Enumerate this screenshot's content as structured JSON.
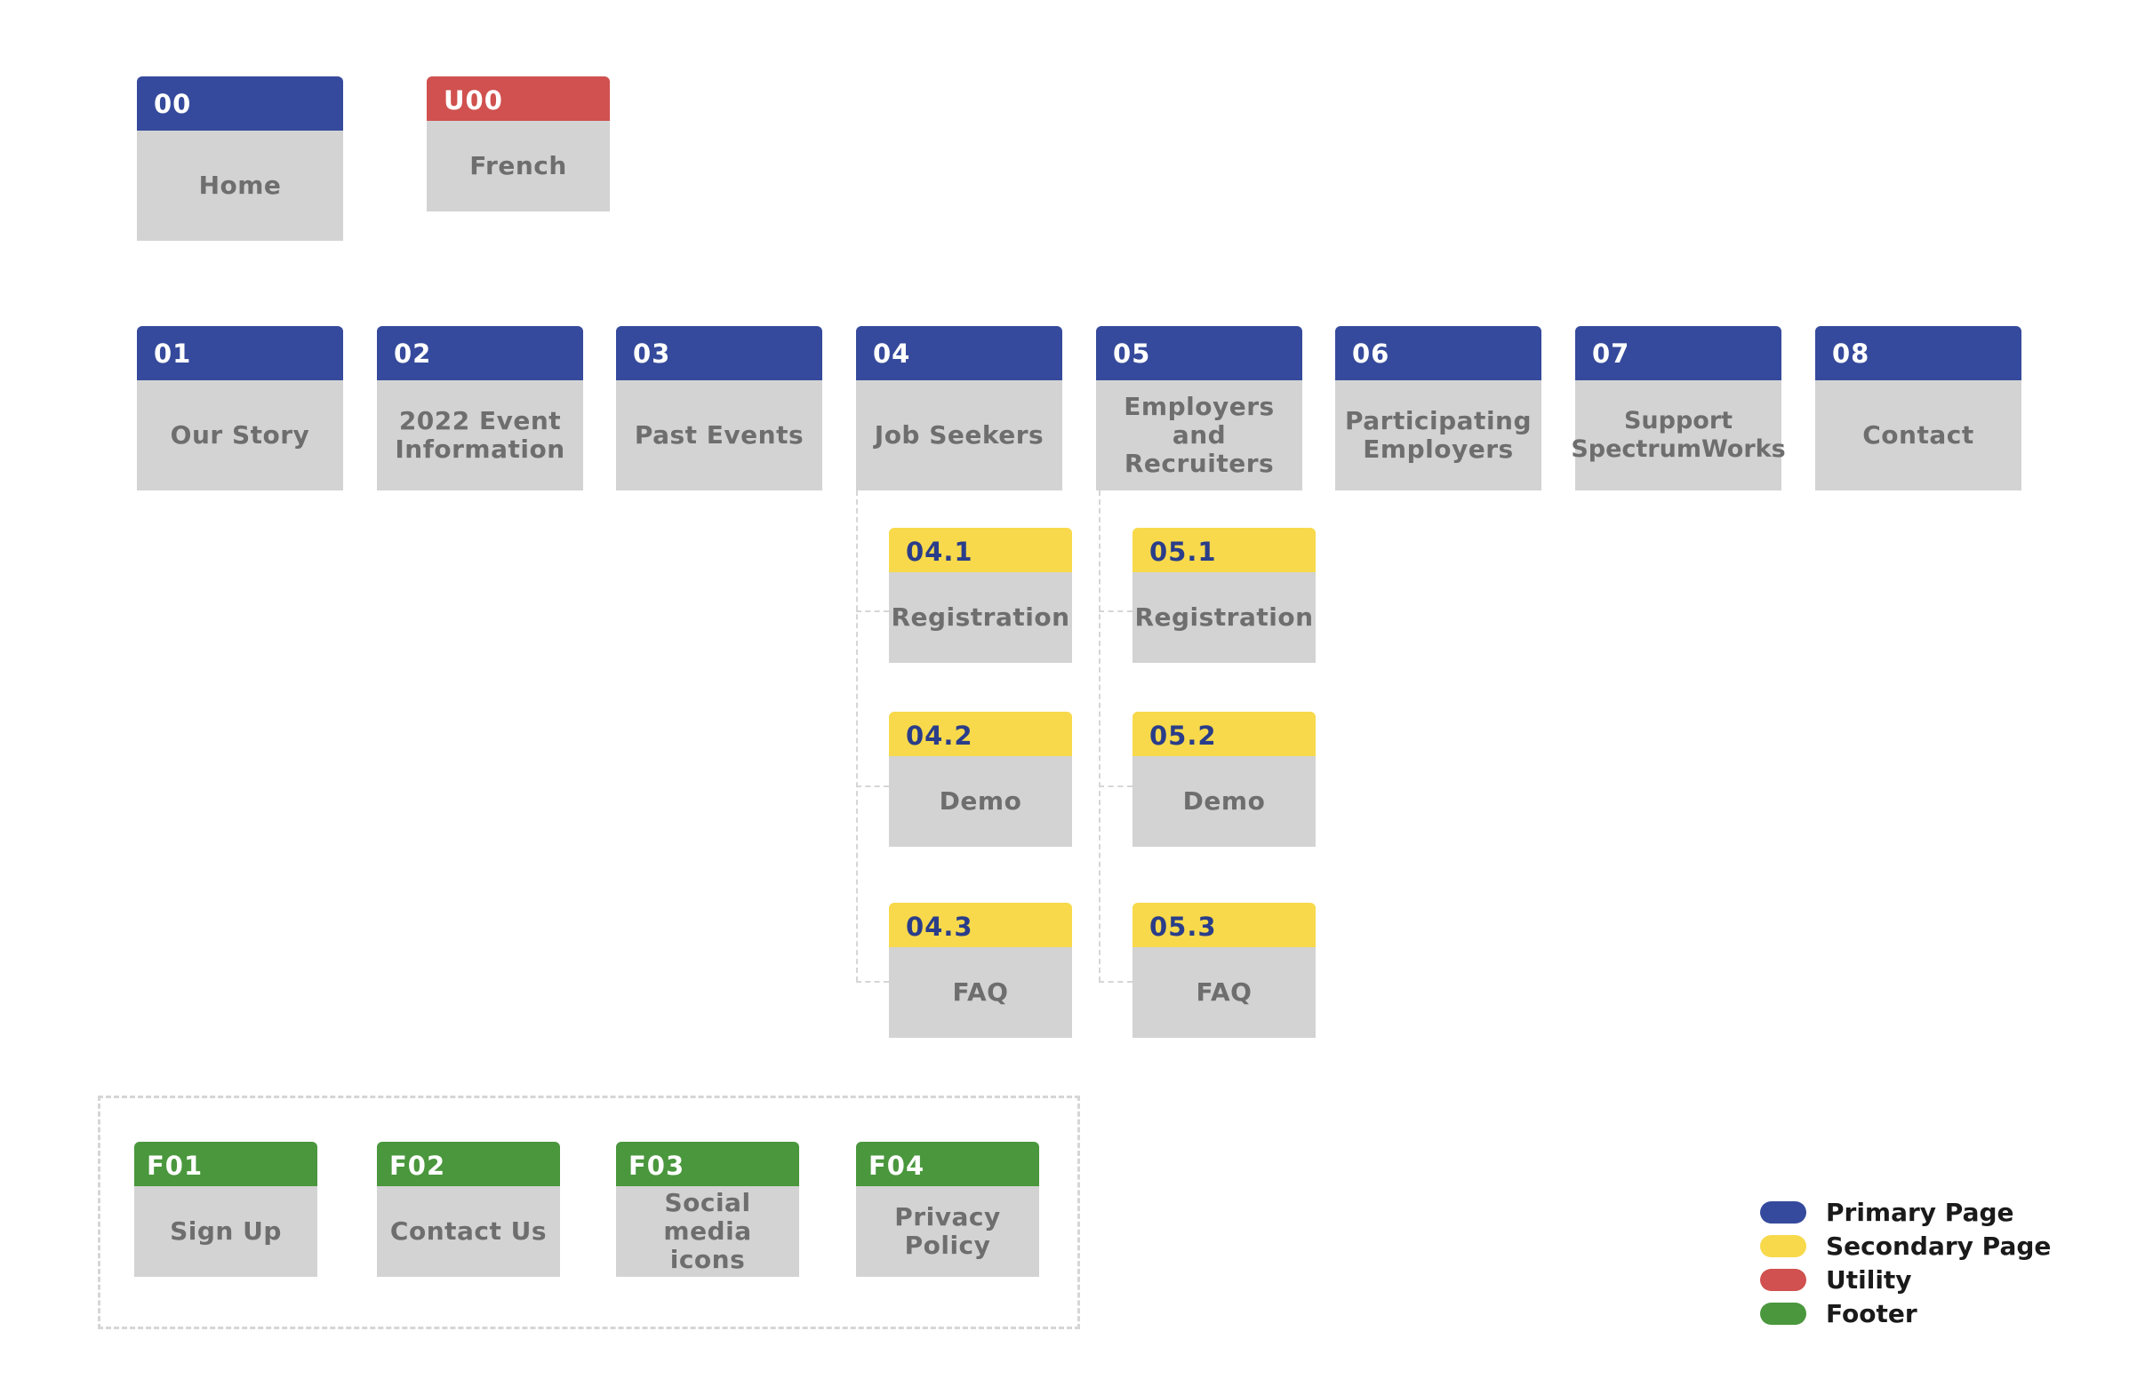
{
  "colors": {
    "primary": "#354a9c",
    "secondary": "#f7d94b",
    "utility": "#d0514f",
    "footer": "#4a973d",
    "card_body": "#d3d3d3"
  },
  "top": {
    "home": {
      "code": "00",
      "label": "Home"
    },
    "french": {
      "code": "U00",
      "label": "French"
    }
  },
  "primary_pages": [
    {
      "code": "01",
      "label": "Our Story"
    },
    {
      "code": "02",
      "label": "2022 Event Information"
    },
    {
      "code": "03",
      "label": "Past Events"
    },
    {
      "code": "04",
      "label": "Job Seekers"
    },
    {
      "code": "05",
      "label": "Employers and Recruiters"
    },
    {
      "code": "06",
      "label": "Participating Employers"
    },
    {
      "code": "07",
      "label": "Support SpectrumWorks"
    },
    {
      "code": "08",
      "label": "Contact"
    }
  ],
  "secondary_04": [
    {
      "code": "04.1",
      "label": "Registration"
    },
    {
      "code": "04.2",
      "label": "Demo"
    },
    {
      "code": "04.3",
      "label": "FAQ"
    }
  ],
  "secondary_05": [
    {
      "code": "05.1",
      "label": "Registration"
    },
    {
      "code": "05.2",
      "label": "Demo"
    },
    {
      "code": "05.3",
      "label": "FAQ"
    }
  ],
  "footer_pages": [
    {
      "code": "F01",
      "label": "Sign Up"
    },
    {
      "code": "F02",
      "label": "Contact Us"
    },
    {
      "code": "F03",
      "label": "Social media icons"
    },
    {
      "code": "F04",
      "label": "Privacy Policy"
    }
  ],
  "legend": [
    {
      "label": "Primary Page",
      "color": "#354a9c"
    },
    {
      "label": "Secondary Page",
      "color": "#f7d94b"
    },
    {
      "label": "Utility",
      "color": "#d0514f"
    },
    {
      "label": "Footer",
      "color": "#4a973d"
    }
  ]
}
